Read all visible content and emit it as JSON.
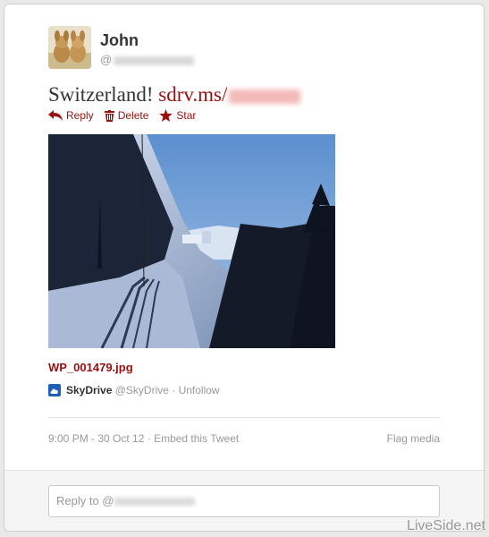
{
  "user": {
    "name": "John",
    "handle_prefix": "@"
  },
  "tweet": {
    "text_before": "Switzerland! ",
    "link_visible": "sdrv.ms/"
  },
  "actions": {
    "reply": "Reply",
    "delete": "Delete",
    "star": "Star"
  },
  "media": {
    "filename": "WP_001479.jpg",
    "source_name": "SkyDrive",
    "source_handle": "@SkyDrive",
    "separator": " · ",
    "unfollow": "Unfollow"
  },
  "meta": {
    "timestamp": "9:00 PM - 30 Oct 12",
    "separator": " · ",
    "embed": "Embed this Tweet",
    "flag": "Flag media"
  },
  "reply": {
    "prefix": "Reply to @"
  },
  "watermark": "LiveSide.net",
  "colors": {
    "link": "#9a0f0f",
    "skydrive_blue": "#1f5fb8"
  }
}
